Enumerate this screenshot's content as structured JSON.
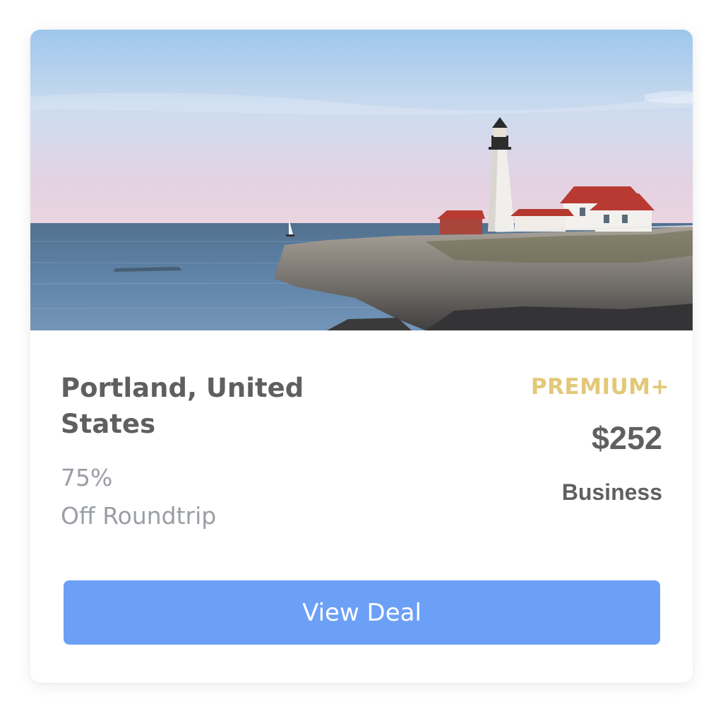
{
  "deal": {
    "destination": "Portland, United States",
    "discount_value": "75%",
    "discount_label": "Off Roundtrip",
    "tier": "PREMIUM+",
    "price": "$252",
    "cabin_class": "Business",
    "cta_label": "View Deal"
  },
  "colors": {
    "tier_accent": "#e2c878",
    "button_bg": "#6ca0f7",
    "title_text": "#5f5f5f",
    "muted_text": "#9a9ea4"
  }
}
